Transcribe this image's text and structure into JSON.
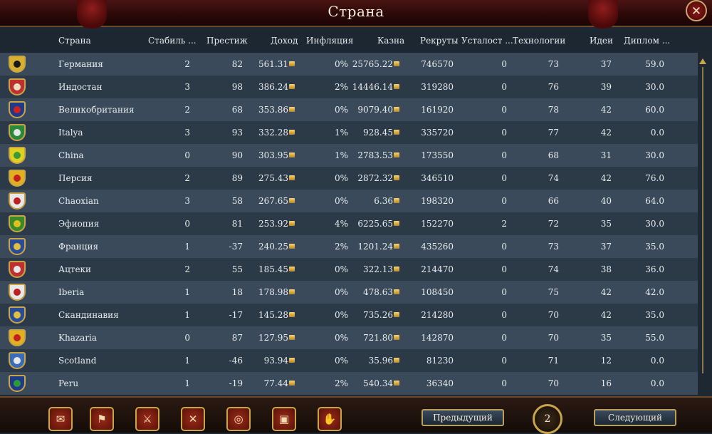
{
  "window": {
    "title": "Страна"
  },
  "columns": [
    "Страна",
    "Стабиль ...",
    "Престиж",
    "Доход",
    "Инфляция",
    "Казна",
    "Рекруты",
    "Усталост ...",
    "Технологии",
    "Идеи",
    "Диплом ..."
  ],
  "rows": [
    {
      "country": "Германия",
      "stability": "2",
      "prestige": "82",
      "income": "561.31",
      "inflation": "0%",
      "treasury": "25765.22",
      "manpower": "746570",
      "weariness": "0",
      "tech": "73",
      "ideas": "37",
      "diplo": "59.0",
      "flag": {
        "bg": "#d8b030",
        "fg": "#1a1a1a"
      }
    },
    {
      "country": "Индостан",
      "stability": "3",
      "prestige": "98",
      "income": "386.24",
      "inflation": "2%",
      "treasury": "14446.14",
      "manpower": "319280",
      "weariness": "0",
      "tech": "76",
      "ideas": "39",
      "diplo": "30.0",
      "flag": {
        "bg": "#c03030",
        "fg": "#e8e0c0"
      }
    },
    {
      "country": "Великобритания",
      "stability": "2",
      "prestige": "68",
      "income": "353.86",
      "inflation": "0%",
      "treasury": "9079.40",
      "manpower": "161920",
      "weariness": "0",
      "tech": "78",
      "ideas": "42",
      "diplo": "60.0",
      "flag": {
        "bg": "#203a8a",
        "fg": "#d02020"
      }
    },
    {
      "country": "Italya",
      "stability": "3",
      "prestige": "93",
      "income": "332.28",
      "inflation": "1%",
      "treasury": "928.45",
      "manpower": "335720",
      "weariness": "0",
      "tech": "77",
      "ideas": "42",
      "diplo": "0.0",
      "flag": {
        "bg": "#2a8a3a",
        "fg": "#e8e8e8"
      }
    },
    {
      "country": "China",
      "stability": "0",
      "prestige": "90",
      "income": "303.95",
      "inflation": "1%",
      "treasury": "2783.53",
      "manpower": "173550",
      "weariness": "0",
      "tech": "68",
      "ideas": "31",
      "diplo": "30.0",
      "flag": {
        "bg": "#e0d020",
        "fg": "#3a9a3a"
      }
    },
    {
      "country": "Персия",
      "stability": "2",
      "prestige": "89",
      "income": "275.43",
      "inflation": "0%",
      "treasury": "2872.32",
      "manpower": "346510",
      "weariness": "0",
      "tech": "74",
      "ideas": "42",
      "diplo": "76.0",
      "flag": {
        "bg": "#e0b020",
        "fg": "#c02020"
      }
    },
    {
      "country": "Chaoxian",
      "stability": "3",
      "prestige": "58",
      "income": "267.65",
      "inflation": "0%",
      "treasury": "6.36",
      "manpower": "198320",
      "weariness": "0",
      "tech": "66",
      "ideas": "40",
      "diplo": "64.0",
      "flag": {
        "bg": "#e8e8e8",
        "fg": "#c02020"
      }
    },
    {
      "country": "Эфиопия",
      "stability": "0",
      "prestige": "81",
      "income": "253.92",
      "inflation": "4%",
      "treasury": "6225.65",
      "manpower": "152270",
      "weariness": "2",
      "tech": "72",
      "ideas": "35",
      "diplo": "30.0",
      "flag": {
        "bg": "#3a8a2a",
        "fg": "#e0c020"
      }
    },
    {
      "country": "Франция",
      "stability": "1",
      "prestige": "-37",
      "income": "240.25",
      "inflation": "2%",
      "treasury": "1201.24",
      "manpower": "435260",
      "weariness": "0",
      "tech": "73",
      "ideas": "37",
      "diplo": "35.0",
      "flag": {
        "bg": "#2a4a9a",
        "fg": "#e0c040"
      }
    },
    {
      "country": "Ацтеки",
      "stability": "2",
      "prestige": "55",
      "income": "185.45",
      "inflation": "0%",
      "treasury": "322.13",
      "manpower": "214470",
      "weariness": "0",
      "tech": "74",
      "ideas": "38",
      "diplo": "36.0",
      "flag": {
        "bg": "#c03030",
        "fg": "#e8e8e8"
      }
    },
    {
      "country": "Iberia",
      "stability": "1",
      "prestige": "18",
      "income": "178.98",
      "inflation": "0%",
      "treasury": "478.63",
      "manpower": "108450",
      "weariness": "0",
      "tech": "75",
      "ideas": "42",
      "diplo": "42.0",
      "flag": {
        "bg": "#e8e8e8",
        "fg": "#c02020"
      }
    },
    {
      "country": "Скандинавия",
      "stability": "1",
      "prestige": "-17",
      "income": "145.28",
      "inflation": "0%",
      "treasury": "735.26",
      "manpower": "214280",
      "weariness": "0",
      "tech": "70",
      "ideas": "42",
      "diplo": "35.0",
      "flag": {
        "bg": "#2a4a9a",
        "fg": "#e0c040"
      }
    },
    {
      "country": "Khazaria",
      "stability": "0",
      "prestige": "87",
      "income": "127.95",
      "inflation": "0%",
      "treasury": "721.80",
      "manpower": "142870",
      "weariness": "0",
      "tech": "70",
      "ideas": "35",
      "diplo": "55.0",
      "flag": {
        "bg": "#e0b020",
        "fg": "#c02020"
      }
    },
    {
      "country": "Scotland",
      "stability": "1",
      "prestige": "-46",
      "income": "93.94",
      "inflation": "0%",
      "treasury": "35.96",
      "manpower": "81230",
      "weariness": "0",
      "tech": "71",
      "ideas": "12",
      "diplo": "0.0",
      "flag": {
        "bg": "#3a6aba",
        "fg": "#e8e8e8"
      }
    },
    {
      "country": "Peru",
      "stability": "1",
      "prestige": "-19",
      "income": "77.44",
      "inflation": "2%",
      "treasury": "540.34",
      "manpower": "36340",
      "weariness": "0",
      "tech": "70",
      "ideas": "16",
      "diplo": "0.0",
      "flag": {
        "bg": "#203a8a",
        "fg": "#2a9a3a"
      }
    }
  ],
  "footer": {
    "icons": [
      "scroll-icon",
      "flag-icon",
      "army-icon",
      "swords-icon",
      "coins-icon",
      "crate-icon",
      "handshake-icon"
    ],
    "icon_glyphs": [
      "✉",
      "⚑",
      "⚔",
      "✕",
      "◎",
      "▣",
      "✋"
    ],
    "prev_label": "Предыдущий",
    "next_label": "Следующий",
    "page": "2"
  },
  "close_glyph": "✕"
}
